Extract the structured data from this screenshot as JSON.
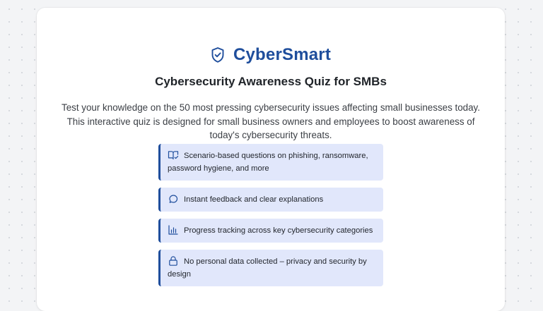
{
  "brand": {
    "name": "CyberSmart",
    "icon": "shield-check-icon",
    "color": "#1f4e9c"
  },
  "quiz": {
    "title": "Cybersecurity Awareness Quiz for SMBs",
    "intro": "Test your knowledge on the 50 most pressing cybersecurity issues affecting small businesses today. This interactive quiz is designed for small business owners and employees to boost awareness of today's cybersecurity threats."
  },
  "features": [
    {
      "icon": "book-open-check-icon",
      "text": "Scenario-based questions on phishing, ransomware, password hygiene, and more"
    },
    {
      "icon": "message-circle-icon",
      "text": "Instant feedback and clear explanations"
    },
    {
      "icon": "bar-chart-icon",
      "text": "Progress tracking across key cybersecurity categories"
    },
    {
      "icon": "lock-icon",
      "text": "No personal data collected – privacy and security by design"
    }
  ],
  "colors": {
    "accent": "#1f4e9c",
    "feature_background": "#e1e7fb",
    "page_background": "#f3f4f6"
  }
}
